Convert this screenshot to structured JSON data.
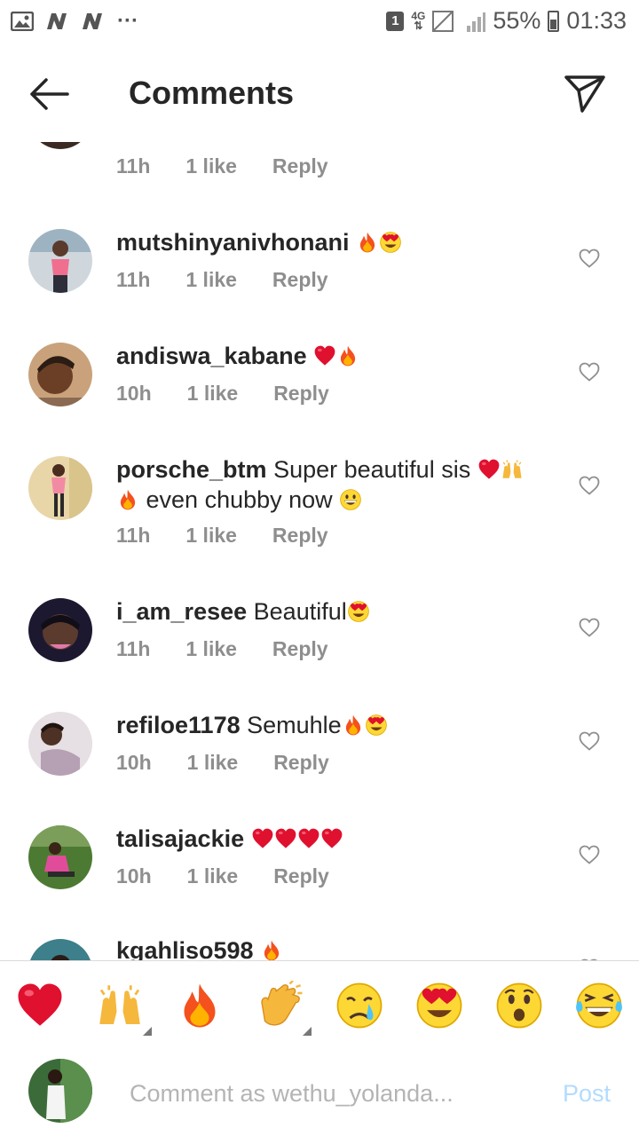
{
  "status_bar": {
    "sim_label": "1",
    "network_top": "4G",
    "network_bottom": "⇅",
    "battery_text": "55%",
    "time": "01:33",
    "notif_dots": "···"
  },
  "header": {
    "title": "Comments"
  },
  "comments": [
    {
      "username": "",
      "text": "",
      "time": "11h",
      "likes": "1 like",
      "reply": "Reply"
    },
    {
      "username": "mutshinyanivhonani",
      "text": "",
      "time": "11h",
      "likes": "1 like",
      "reply": "Reply"
    },
    {
      "username": "andiswa_kabane",
      "text": "",
      "time": "10h",
      "likes": "1 like",
      "reply": "Reply"
    },
    {
      "username": "porsche_btm",
      "text": "Super beautiful sis",
      "text2": "even chubby now",
      "time": "11h",
      "likes": "1 like",
      "reply": "Reply"
    },
    {
      "username": "i_am_resee",
      "text": "Beautiful",
      "time": "11h",
      "likes": "1 like",
      "reply": "Reply"
    },
    {
      "username": "refiloe1178",
      "text": "Semuhle",
      "time": "10h",
      "likes": "1 like",
      "reply": "Reply"
    },
    {
      "username": "talisajackie",
      "text": "",
      "time": "10h",
      "likes": "1 like",
      "reply": "Reply"
    },
    {
      "username": "kgahliso598",
      "text": ""
    }
  ],
  "quick_emojis": [
    "red-heart",
    "raising-hands",
    "fire",
    "clapping-hands",
    "crying-face",
    "heart-eyes-face",
    "surprised-face",
    "tears-of-joy-face"
  ],
  "comment_bar": {
    "placeholder": "Comment as wethu_yolanda...",
    "post_label": "Post"
  },
  "colors": {
    "text": "#262626",
    "meta": "#8e8e8e",
    "post_disabled": "#b3dbff",
    "heart_red": "#e0102f"
  }
}
